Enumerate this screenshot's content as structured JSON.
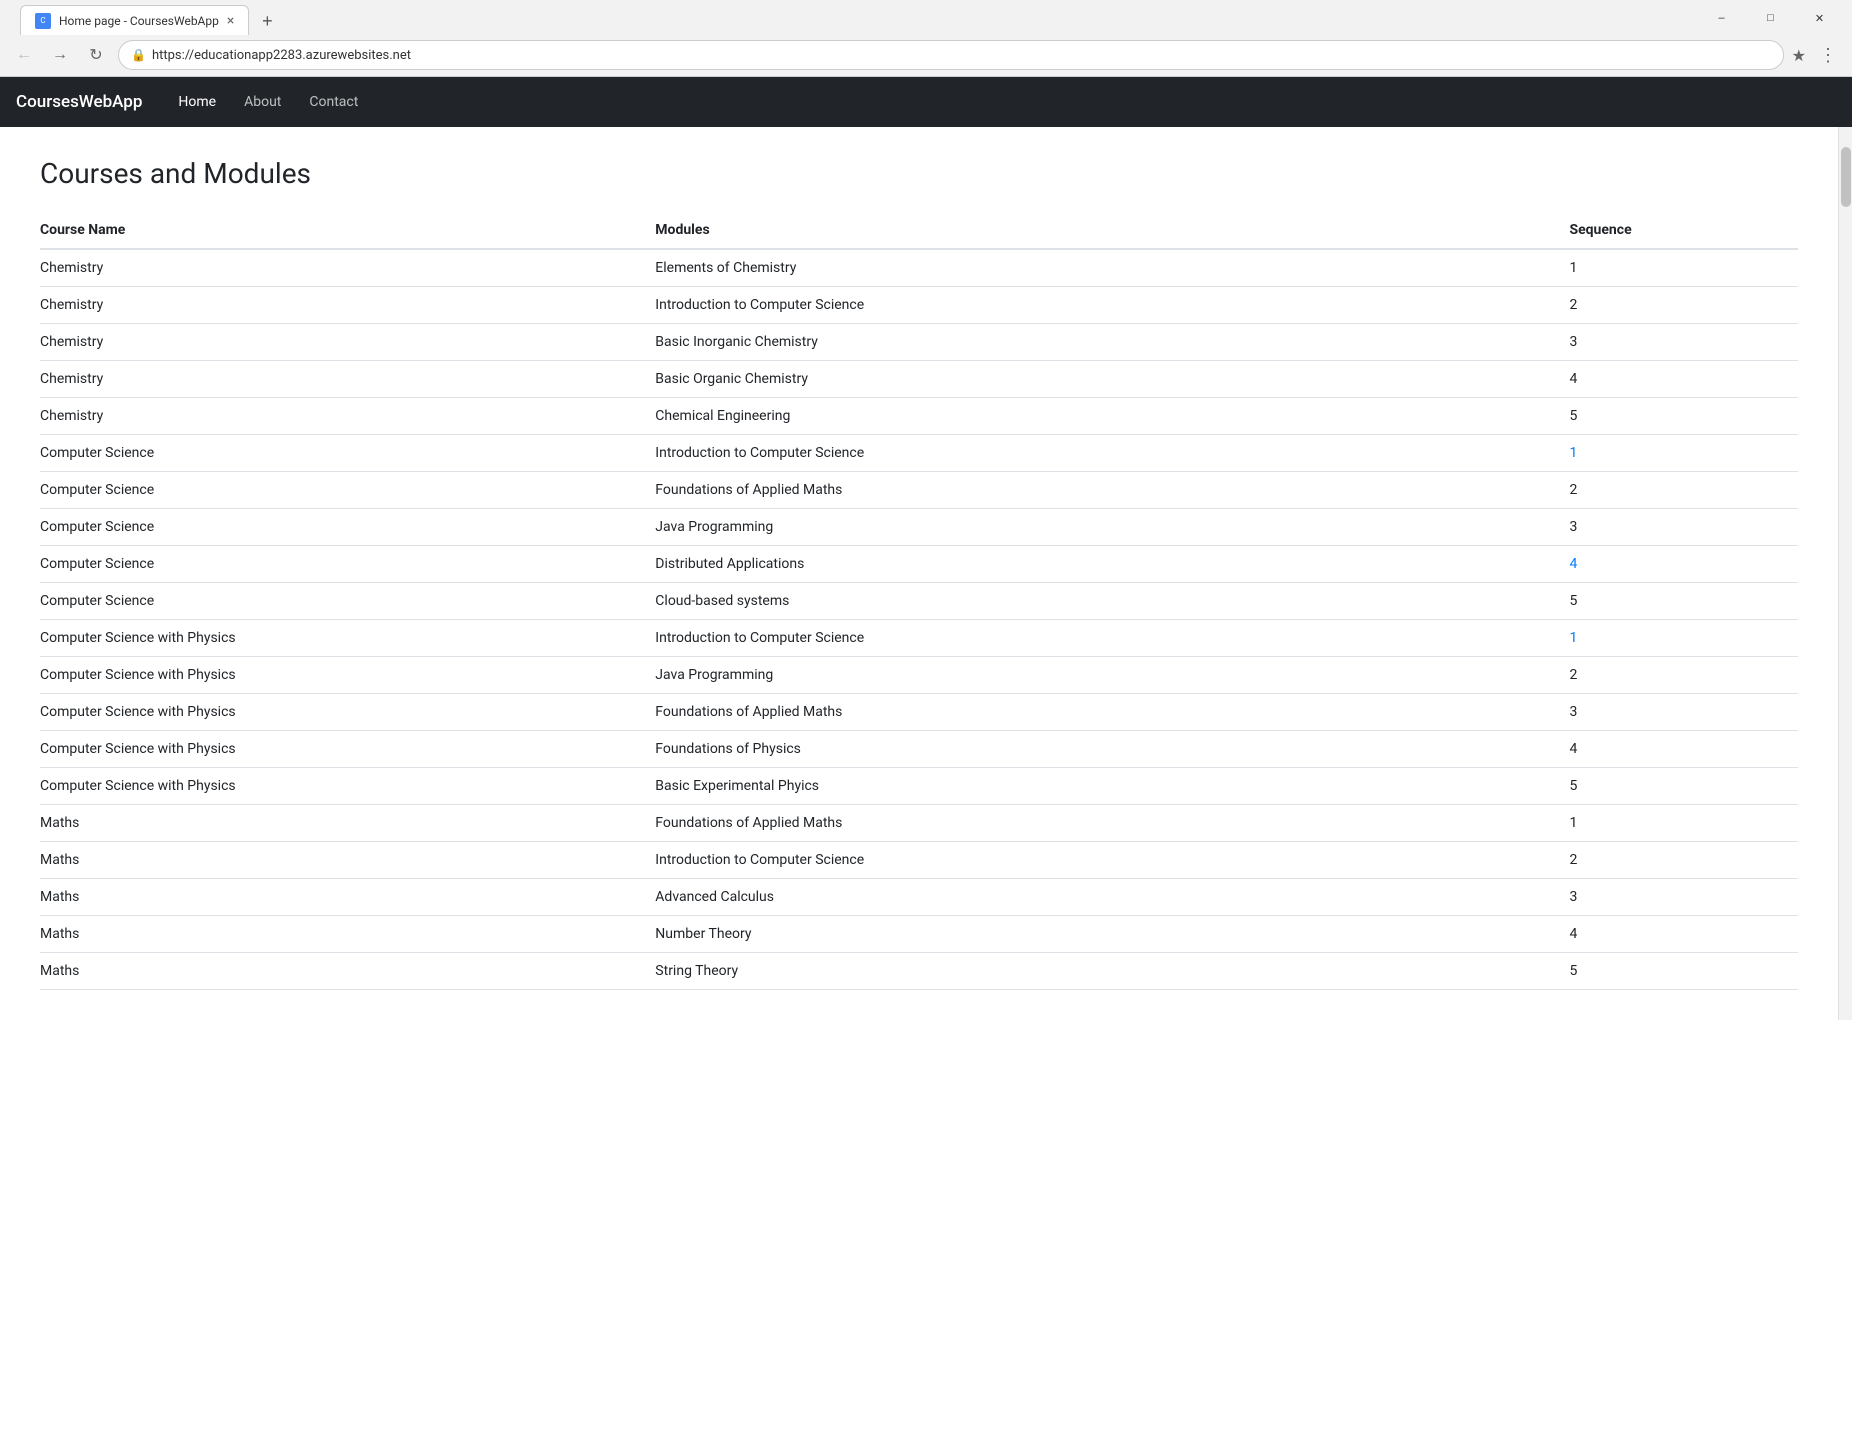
{
  "browser": {
    "tab_title": "Home page - CoursesWebApp",
    "url": "https://educationapp2283.azurewebsites.net",
    "new_tab_icon": "+",
    "back_disabled": false,
    "forward_disabled": true
  },
  "navbar": {
    "brand": "CoursesWebApp",
    "links": [
      {
        "label": "Home",
        "active": true
      },
      {
        "label": "About",
        "active": false
      },
      {
        "label": "Contact",
        "active": false
      }
    ]
  },
  "page": {
    "title": "Courses and Modules",
    "table": {
      "headers": [
        "Course Name",
        "Modules",
        "Sequence"
      ],
      "rows": [
        {
          "course": "Chemistry",
          "module": "Elements of Chemistry",
          "seq": "1",
          "seq_colored": false
        },
        {
          "course": "Chemistry",
          "module": "Introduction to Computer Science",
          "seq": "2",
          "seq_colored": false
        },
        {
          "course": "Chemistry",
          "module": "Basic Inorganic Chemistry",
          "seq": "3",
          "seq_colored": false
        },
        {
          "course": "Chemistry",
          "module": "Basic Organic Chemistry",
          "seq": "4",
          "seq_colored": false
        },
        {
          "course": "Chemistry",
          "module": "Chemical Engineering",
          "seq": "5",
          "seq_colored": false
        },
        {
          "course": "Computer Science",
          "module": "Introduction to Computer Science",
          "seq": "1",
          "seq_colored": true
        },
        {
          "course": "Computer Science",
          "module": "Foundations of Applied Maths",
          "seq": "2",
          "seq_colored": false
        },
        {
          "course": "Computer Science",
          "module": "Java Programming",
          "seq": "3",
          "seq_colored": false
        },
        {
          "course": "Computer Science",
          "module": "Distributed Applications",
          "seq": "4",
          "seq_colored": true
        },
        {
          "course": "Computer Science",
          "module": "Cloud-based systems",
          "seq": "5",
          "seq_colored": false
        },
        {
          "course": "Computer Science with Physics",
          "module": "Introduction to Computer Science",
          "seq": "1",
          "seq_colored": true
        },
        {
          "course": "Computer Science with Physics",
          "module": "Java Programming",
          "seq": "2",
          "seq_colored": false
        },
        {
          "course": "Computer Science with Physics",
          "module": "Foundations of Applied Maths",
          "seq": "3",
          "seq_colored": false
        },
        {
          "course": "Computer Science with Physics",
          "module": "Foundations of Physics",
          "seq": "4",
          "seq_colored": false
        },
        {
          "course": "Computer Science with Physics",
          "module": "Basic Experimental Phyics",
          "seq": "5",
          "seq_colored": false
        },
        {
          "course": "Maths",
          "module": "Foundations of Applied Maths",
          "seq": "1",
          "seq_colored": false
        },
        {
          "course": "Maths",
          "module": "Introduction to Computer Science",
          "seq": "2",
          "seq_colored": false
        },
        {
          "course": "Maths",
          "module": "Advanced Calculus",
          "seq": "3",
          "seq_colored": false
        },
        {
          "course": "Maths",
          "module": "Number Theory",
          "seq": "4",
          "seq_colored": false
        },
        {
          "course": "Maths",
          "module": "String Theory",
          "seq": "5",
          "seq_colored": false
        }
      ]
    }
  }
}
